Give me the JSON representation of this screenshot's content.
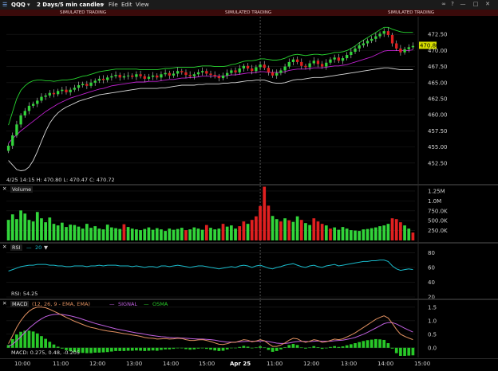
{
  "window": {
    "symbol": "QQQ",
    "period": "2 Days/5 min candles",
    "menu": [
      "File",
      "Edit",
      "View"
    ],
    "simulated": [
      "SIMULATED TRADING",
      "SIMULATED TRADING",
      "SIMULATED TRADING"
    ]
  },
  "colors": {
    "up": "#32d43a",
    "down": "#e02020",
    "bband": "#27d42f",
    "bband_lower": "#d8d8d8",
    "ma": "#c020d0",
    "rsi": "#19b9c9",
    "macd": "#e09060",
    "signal": "#c060e0",
    "osma": "#28c828",
    "last_price_bg": "#d8e000"
  },
  "chart_data": [
    {
      "type": "candlestick",
      "name": "price",
      "ohlc_readout": "4/25 14:15  H: 470.80  L: 470.47  C: 470.72",
      "last_price_label": "470.80",
      "ylim": [
        450.5,
        474.5
      ],
      "yticks": [
        "472.50",
        "470.00",
        "467.50",
        "465.00",
        "462.50",
        "460.00",
        "457.50",
        "455.00",
        "452.50"
      ],
      "ytick_values": [
        472.5,
        470,
        467.5,
        465,
        462.5,
        460,
        457.5,
        455,
        452.5
      ],
      "close": [
        455.2,
        456.8,
        458.5,
        459.9,
        460.6,
        461.4,
        461.7,
        462.2,
        462.8,
        463.0,
        463.4,
        463.2,
        463.7,
        463.9,
        463.5,
        463.9,
        464.2,
        464.6,
        464.8,
        464.5,
        465.0,
        465.3,
        465.6,
        465.4,
        465.8,
        466.0,
        466.2,
        465.8,
        466.0,
        466.1,
        465.9,
        466.3,
        466.0,
        465.6,
        465.9,
        466.1,
        465.8,
        466.3,
        466.5,
        466.1,
        466.4,
        466.8,
        466.6,
        466.2,
        466.0,
        466.3,
        466.6,
        466.8,
        466.4,
        466.2,
        466.0,
        465.7,
        466.1,
        466.5,
        466.9,
        466.6,
        467.2,
        467.6,
        467.2,
        466.8,
        467.4,
        467.8,
        467.3,
        466.6,
        466.1,
        466.5,
        466.9,
        467.5,
        468.2,
        468.6,
        468.2,
        467.6,
        467.4,
        468.0,
        468.4,
        467.9,
        467.5,
        468.1,
        468.6,
        468.9,
        468.4,
        468.8,
        469.3,
        469.8,
        470.3,
        470.8,
        471.1,
        471.5,
        471.8,
        472.2,
        472.6,
        473.0,
        472.4,
        471.1,
        470.3,
        469.7,
        470.2,
        470.5,
        470.7
      ],
      "bb_upper": [
        458.4,
        460.5,
        462.5,
        463.8,
        464.5,
        465.0,
        465.3,
        465.4,
        465.4,
        465.3,
        465.3,
        465.2,
        465.3,
        465.4,
        465.4,
        465.5,
        465.6,
        465.8,
        466.0,
        466.1,
        466.3,
        466.5,
        466.7,
        466.8,
        466.9,
        467.0,
        467.1,
        467.1,
        467.1,
        467.1,
        467.1,
        467.1,
        467.0,
        467.0,
        467.0,
        467.0,
        467.0,
        467.1,
        467.2,
        467.2,
        467.3,
        467.4,
        467.4,
        467.4,
        467.4,
        467.4,
        467.5,
        467.6,
        467.6,
        467.6,
        467.5,
        467.5,
        467.5,
        467.6,
        467.8,
        467.9,
        468.1,
        468.3,
        468.4,
        468.4,
        468.5,
        468.7,
        468.7,
        468.6,
        468.5,
        468.5,
        468.6,
        468.8,
        469.1,
        469.3,
        469.4,
        469.3,
        469.2,
        469.3,
        469.4,
        469.4,
        469.3,
        469.4,
        469.5,
        469.7,
        469.7,
        469.8,
        470.0,
        470.3,
        470.7,
        471.2,
        471.6,
        472.0,
        472.4,
        472.8,
        473.2,
        473.6,
        473.6,
        473.3,
        473.1,
        472.9,
        472.8,
        472.8,
        472.8
      ],
      "bb_lower": [
        452.9,
        452.2,
        451.5,
        451.3,
        451.4,
        451.9,
        452.9,
        454.3,
        455.9,
        457.4,
        458.7,
        459.6,
        460.3,
        460.8,
        461.2,
        461.5,
        461.8,
        462.1,
        462.3,
        462.5,
        462.7,
        462.9,
        463.1,
        463.2,
        463.3,
        463.4,
        463.5,
        463.6,
        463.7,
        463.8,
        463.9,
        464.0,
        464.1,
        464.1,
        464.1,
        464.1,
        464.1,
        464.2,
        464.2,
        464.3,
        464.4,
        464.5,
        464.6,
        464.6,
        464.6,
        464.6,
        464.7,
        464.7,
        464.8,
        464.8,
        464.8,
        464.8,
        464.9,
        464.9,
        465.0,
        465.0,
        465.1,
        465.2,
        465.3,
        465.3,
        465.4,
        465.4,
        465.4,
        465.2,
        465.0,
        464.9,
        464.9,
        465.0,
        465.2,
        465.4,
        465.5,
        465.5,
        465.6,
        465.7,
        465.8,
        465.8,
        465.8,
        465.9,
        466.0,
        466.1,
        466.2,
        466.3,
        466.4,
        466.5,
        466.6,
        466.7,
        466.8,
        466.9,
        467.0,
        467.1,
        467.2,
        467.3,
        467.3,
        467.2,
        467.1,
        467.0,
        467.0,
        467.0,
        467.0
      ],
      "ma": [
        455.6,
        456.3,
        456.9,
        457.5,
        458.0,
        458.5,
        459.0,
        459.5,
        460.0,
        460.5,
        460.9,
        461.3,
        461.7,
        462.0,
        462.3,
        462.6,
        462.8,
        463.0,
        463.2,
        463.4,
        463.6,
        463.8,
        464.0,
        464.1,
        464.3,
        464.5,
        464.6,
        464.7,
        464.8,
        464.9,
        465.0,
        465.1,
        465.1,
        465.1,
        465.2,
        465.2,
        465.2,
        465.3,
        465.4,
        465.5,
        465.5,
        465.6,
        465.7,
        465.7,
        465.8,
        465.8,
        465.9,
        466.0,
        466.0,
        466.0,
        466.0,
        466.0,
        466.0,
        466.1,
        466.2,
        466.2,
        466.3,
        466.4,
        466.5,
        466.5,
        466.6,
        466.7,
        466.7,
        466.6,
        466.6,
        466.6,
        466.6,
        466.7,
        466.9,
        467.0,
        467.1,
        467.1,
        467.1,
        467.2,
        467.3,
        467.3,
        467.3,
        467.4,
        467.5,
        467.6,
        467.6,
        467.7,
        467.8,
        468.0,
        468.2,
        468.4,
        468.6,
        468.8,
        469.0,
        469.3,
        469.6,
        469.9,
        470.0,
        470.0,
        470.0,
        470.0,
        470.0,
        470.0,
        470.1
      ]
    },
    {
      "type": "bar",
      "name": "Volume",
      "title": "Volume",
      "ylim": [
        0,
        1350000
      ],
      "yticks": [
        "1.25M",
        "1.0M",
        "750.0K",
        "500.0K",
        "250.0K"
      ],
      "ytick_values": [
        1250000,
        1000000,
        750000,
        500000,
        250000
      ],
      "values": [
        520000,
        660000,
        540000,
        760000,
        680000,
        520000,
        480000,
        720000,
        560000,
        460000,
        580000,
        420000,
        380000,
        450000,
        340000,
        400000,
        390000,
        350000,
        300000,
        420000,
        320000,
        360000,
        300000,
        280000,
        400000,
        330000,
        310000,
        290000,
        410000,
        340000,
        300000,
        280000,
        260000,
        290000,
        330000,
        270000,
        310000,
        280000,
        240000,
        300000,
        270000,
        290000,
        320000,
        260000,
        280000,
        330000,
        300000,
        270000,
        390000,
        320000,
        280000,
        300000,
        420000,
        350000,
        380000,
        300000,
        360000,
        480000,
        420000,
        520000,
        610000,
        870000,
        1360000,
        880000,
        620000,
        540000,
        480000,
        560000,
        510000,
        470000,
        610000,
        520000,
        440000,
        390000,
        560000,
        480000,
        420000,
        380000,
        300000,
        330000,
        270000,
        340000,
        300000,
        260000,
        250000,
        240000,
        280000,
        290000,
        310000,
        330000,
        360000,
        380000,
        420000,
        560000,
        540000,
        460000,
        380000,
        300000,
        200000
      ],
      "up": [
        true,
        true,
        true,
        true,
        true,
        true,
        true,
        true,
        true,
        true,
        true,
        true,
        true,
        true,
        true,
        true,
        true,
        true,
        true,
        true,
        true,
        true,
        true,
        true,
        true,
        true,
        true,
        true,
        false,
        true,
        true,
        true,
        true,
        true,
        true,
        true,
        true,
        true,
        true,
        true,
        true,
        true,
        true,
        false,
        true,
        true,
        true,
        true,
        false,
        true,
        true,
        true,
        false,
        true,
        true,
        true,
        false,
        false,
        true,
        false,
        false,
        false,
        false,
        false,
        true,
        true,
        false,
        true,
        false,
        true,
        true,
        false,
        true,
        true,
        false,
        false,
        false,
        true,
        false,
        true,
        true,
        true,
        true,
        true,
        true,
        true,
        true,
        true,
        true,
        true,
        true,
        true,
        true,
        false,
        false,
        false,
        true,
        true,
        false
      ]
    },
    {
      "type": "line",
      "name": "RSI",
      "title": "RSI",
      "param": "20",
      "readout": "RSI: 54.25",
      "ylim": [
        20,
        90
      ],
      "yticks": [
        "80",
        "60",
        "40",
        "20"
      ],
      "ytick_values": [
        80,
        60,
        40,
        20
      ],
      "values": [
        55,
        57,
        59,
        61,
        62,
        63,
        63,
        64,
        64,
        64,
        63,
        63,
        62,
        62,
        61,
        61,
        62,
        62,
        62,
        61,
        62,
        62,
        63,
        62,
        63,
        63,
        63,
        62,
        62,
        62,
        61,
        62,
        61,
        60,
        61,
        61,
        60,
        62,
        62,
        61,
        62,
        63,
        62,
        61,
        60,
        61,
        62,
        62,
        61,
        60,
        59,
        58,
        59,
        60,
        61,
        60,
        62,
        63,
        62,
        60,
        62,
        63,
        61,
        59,
        58,
        60,
        61,
        63,
        64,
        65,
        63,
        61,
        60,
        62,
        63,
        61,
        60,
        62,
        63,
        64,
        62,
        63,
        64,
        65,
        66,
        67,
        68,
        68,
        69,
        69,
        70,
        70,
        68,
        62,
        58,
        56,
        57,
        58,
        57
      ]
    },
    {
      "type": "line",
      "name": "MACD",
      "title": "MACD",
      "params": "(12, 26, 9 - EMA, EMA)",
      "legend": [
        "SIGNAL",
        "OSMA"
      ],
      "readout": "MACD: 0.275, 0.48, -0.205",
      "ylim": [
        -0.3,
        1.7
      ],
      "yticks": [
        "1.5",
        "1.0",
        "0.5",
        "0.0"
      ],
      "ytick_values": [
        1.5,
        1.0,
        0.5,
        0.0
      ],
      "macd": [
        0.15,
        0.45,
        0.75,
        1.0,
        1.2,
        1.35,
        1.45,
        1.5,
        1.5,
        1.48,
        1.42,
        1.35,
        1.28,
        1.2,
        1.12,
        1.05,
        0.98,
        0.92,
        0.86,
        0.8,
        0.75,
        0.72,
        0.68,
        0.65,
        0.62,
        0.6,
        0.58,
        0.55,
        0.52,
        0.5,
        0.47,
        0.45,
        0.42,
        0.38,
        0.36,
        0.35,
        0.32,
        0.33,
        0.34,
        0.32,
        0.33,
        0.35,
        0.34,
        0.3,
        0.27,
        0.27,
        0.29,
        0.3,
        0.27,
        0.23,
        0.18,
        0.13,
        0.12,
        0.15,
        0.2,
        0.2,
        0.25,
        0.3,
        0.28,
        0.22,
        0.25,
        0.3,
        0.26,
        0.15,
        0.05,
        0.05,
        0.1,
        0.18,
        0.28,
        0.35,
        0.33,
        0.25,
        0.2,
        0.24,
        0.3,
        0.27,
        0.2,
        0.22,
        0.27,
        0.32,
        0.3,
        0.33,
        0.4,
        0.47,
        0.55,
        0.65,
        0.75,
        0.85,
        0.95,
        1.05,
        1.12,
        1.18,
        1.1,
        0.9,
        0.68,
        0.5,
        0.42,
        0.36,
        0.3
      ],
      "signal": [
        0.05,
        0.13,
        0.26,
        0.41,
        0.57,
        0.72,
        0.85,
        0.97,
        1.07,
        1.15,
        1.2,
        1.23,
        1.24,
        1.23,
        1.21,
        1.18,
        1.14,
        1.1,
        1.05,
        1.0,
        0.95,
        0.9,
        0.86,
        0.82,
        0.78,
        0.74,
        0.7,
        0.67,
        0.64,
        0.61,
        0.58,
        0.55,
        0.53,
        0.5,
        0.47,
        0.45,
        0.43,
        0.41,
        0.4,
        0.38,
        0.37,
        0.37,
        0.36,
        0.35,
        0.34,
        0.33,
        0.32,
        0.32,
        0.31,
        0.3,
        0.28,
        0.25,
        0.23,
        0.21,
        0.21,
        0.21,
        0.22,
        0.23,
        0.24,
        0.24,
        0.24,
        0.25,
        0.25,
        0.23,
        0.2,
        0.17,
        0.16,
        0.16,
        0.18,
        0.21,
        0.23,
        0.24,
        0.23,
        0.23,
        0.24,
        0.25,
        0.24,
        0.24,
        0.24,
        0.26,
        0.27,
        0.28,
        0.31,
        0.34,
        0.38,
        0.44,
        0.5,
        0.57,
        0.65,
        0.73,
        0.81,
        0.89,
        0.93,
        0.93,
        0.88,
        0.8,
        0.72,
        0.65,
        0.58
      ],
      "osma": [
        0.1,
        0.32,
        0.49,
        0.59,
        0.63,
        0.63,
        0.6,
        0.53,
        0.43,
        0.33,
        0.22,
        0.12,
        0.04,
        -0.03,
        -0.09,
        -0.13,
        -0.16,
        -0.18,
        -0.19,
        -0.2,
        -0.2,
        -0.18,
        -0.18,
        -0.17,
        -0.16,
        -0.14,
        -0.12,
        -0.12,
        -0.12,
        -0.11,
        -0.11,
        -0.1,
        -0.11,
        -0.12,
        -0.11,
        -0.1,
        -0.11,
        -0.08,
        -0.06,
        -0.06,
        -0.04,
        -0.02,
        -0.02,
        -0.05,
        -0.07,
        -0.06,
        -0.03,
        -0.02,
        -0.04,
        -0.07,
        -0.1,
        -0.12,
        -0.11,
        -0.06,
        -0.01,
        -0.01,
        0.03,
        0.07,
        0.04,
        -0.02,
        0.01,
        0.05,
        0.01,
        -0.08,
        -0.15,
        -0.12,
        -0.06,
        0.02,
        0.1,
        0.14,
        0.1,
        0.01,
        -0.03,
        0.01,
        0.06,
        0.02,
        -0.04,
        -0.02,
        0.03,
        0.06,
        0.03,
        0.05,
        0.09,
        0.13,
        0.17,
        0.21,
        0.25,
        0.28,
        0.3,
        0.32,
        0.31,
        0.29,
        0.17,
        -0.03,
        -0.2,
        -0.3,
        -0.3,
        -0.29,
        -0.28
      ]
    }
  ],
  "xaxis": {
    "ticks": [
      "10:00",
      "11:00",
      "12:00",
      "13:00",
      "14:00",
      "15:00",
      "Apr 25",
      "11:00",
      "12:00",
      "13:00",
      "14:00",
      "15:00"
    ],
    "bold_index": 6
  }
}
